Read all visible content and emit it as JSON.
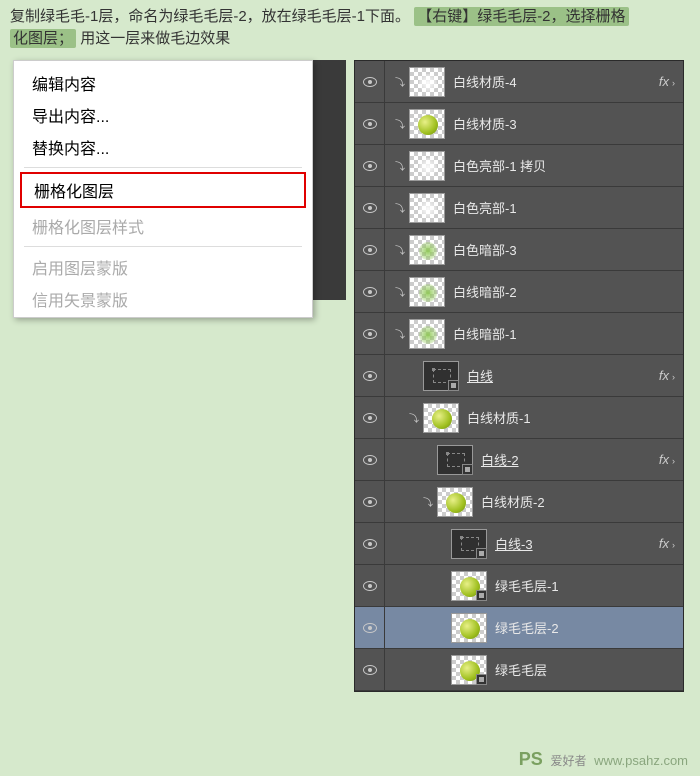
{
  "instruction": {
    "part1": "复制绿毛毛-1层，命名为绿毛毛层-2，放在绿毛毛层-1下面。",
    "hl1": "【右键】绿毛毛层-2，选择栅格",
    "hl2": "化图层；",
    "part2": "用这一层来做毛边效果"
  },
  "menu": {
    "edit_content": "编辑内容",
    "export_content": "导出内容...",
    "replace_content": "替换内容...",
    "rasterize_layer": "栅格化图层",
    "rasterize_style": "栅格化图层样式",
    "enable_layer_mask": "启用图层蒙版",
    "enable_vector_mask": "信用矢景蒙版"
  },
  "fx_label": "fx",
  "layers": [
    {
      "name": "白线材质-4",
      "thumb": "checker",
      "content": "blur-white",
      "fx": true,
      "link": true
    },
    {
      "name": "白线材质-3",
      "thumb": "checker",
      "content": "ball",
      "link": true
    },
    {
      "name": "白色亮部-1 拷贝",
      "thumb": "checker",
      "content": "blur-white",
      "link": true
    },
    {
      "name": "白色亮部-1",
      "thumb": "checker",
      "content": "blur-white",
      "link": true
    },
    {
      "name": "白色暗部-3",
      "thumb": "checker",
      "content": "blur-green",
      "link": true
    },
    {
      "name": "白线暗部-2",
      "thumb": "checker",
      "content": "blur-green",
      "link": true
    },
    {
      "name": "白线暗部-1",
      "thumb": "checker",
      "content": "blur-green",
      "link": true
    },
    {
      "name": "白线",
      "thumb": "dark",
      "content": "sel-box",
      "smart": true,
      "underline": true,
      "fx": true,
      "indent": 1
    },
    {
      "name": "白线材质-1",
      "thumb": "checker",
      "content": "ball",
      "link": true,
      "indent": 1
    },
    {
      "name": "白线-2",
      "thumb": "dark",
      "content": "sel-box",
      "smart": true,
      "underline": true,
      "fx": true,
      "indent": 2
    },
    {
      "name": "白线材质-2",
      "thumb": "checker",
      "content": "ball",
      "link": true,
      "indent": 2
    },
    {
      "name": "白线-3",
      "thumb": "dark",
      "content": "sel-box",
      "smart": true,
      "underline": true,
      "fx": true,
      "indent": 3
    },
    {
      "name": "绿毛毛层-1",
      "thumb": "checker",
      "content": "ball",
      "smart": true,
      "indent": 3
    },
    {
      "name": "绿毛毛层-2",
      "thumb": "checker",
      "content": "ball",
      "selected": true,
      "indent": 3
    },
    {
      "name": "绿毛毛层",
      "thumb": "checker",
      "content": "ball",
      "smart": true,
      "indent": 3
    }
  ],
  "watermark": {
    "ps": "PS",
    "cn": "爱好者",
    "url": "www.psahz.com"
  }
}
